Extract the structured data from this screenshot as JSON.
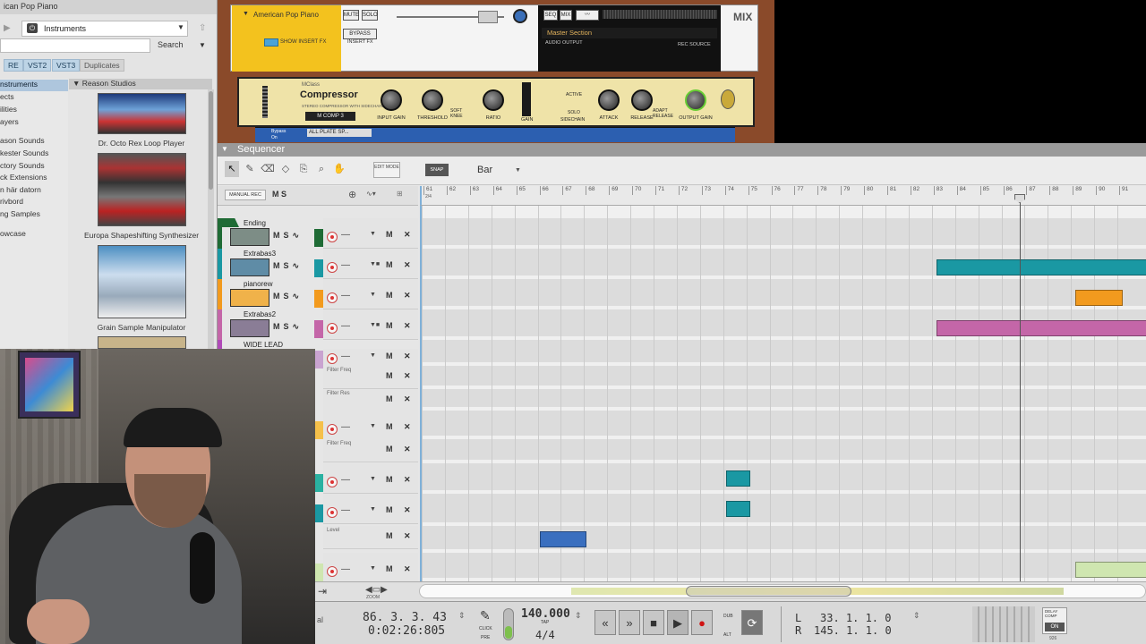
{
  "browser": {
    "title": "ican Pop Piano",
    "location": "Instruments",
    "search_label": "Search",
    "filter_tabs": [
      "RE",
      "VST2",
      "VST3",
      "Duplicates"
    ],
    "sidebar_items": [
      "nstruments",
      "ects",
      "ilities",
      "ayers",
      "ason Sounds",
      "kester Sounds",
      "ctory Sounds",
      "ck Extensions",
      "n här datorn",
      "rivbord",
      "ng Samples",
      "owcase"
    ],
    "folder": "Reason Studios",
    "devices": [
      "Dr. Octo Rex Loop Player",
      "Europa Shapeshifting Synthesizer",
      "Grain Sample Manipulator"
    ]
  },
  "rack": {
    "piano_name": "American Pop Piano",
    "show_insert_fx": "SHOW INSERT FX",
    "mute": "MUTE",
    "solo": "SOLO",
    "bypass": "BYPASS",
    "insert_fx": "INSERT FX",
    "seq": "SEQ",
    "mix_btn": "MIX",
    "master_section": "Master Section",
    "audio_output": "AUDIO OUTPUT",
    "rec_source": "REC SOURCE",
    "mix_label": "MIX",
    "comp_brand": "MClass",
    "comp_name": "Compressor",
    "comp_sub": "STEREO COMPRESSOR WITH SIDECHAIN",
    "comp_patch": "M COMP 3",
    "knobs": [
      "INPUT GAIN",
      "THRESHOLD",
      "RATIO",
      "ATTACK",
      "RELEASE",
      "OUTPUT GAIN"
    ],
    "soft_knee": "SOFT KNEE",
    "gain": "GAIN",
    "active": "ACTIVE",
    "sidechain": "SIDECHAIN",
    "solo_sc": "SOLO",
    "adapt_release": "ADAPT RELEASE",
    "plate_bypass": "Bypass",
    "plate_on": "On",
    "plate_patch": "ALL PLATE SP..."
  },
  "sequencer": {
    "title": "Sequencer",
    "edit_mode": "EDIT MODE",
    "snap": "SNAP",
    "snap_value": "Bar",
    "manual_rec": "MANUAL REC",
    "ms": "M S",
    "ruler_bars": [
      "61",
      "62",
      "63",
      "64",
      "65",
      "66",
      "67",
      "68",
      "69",
      "70",
      "71",
      "72",
      "73",
      "74",
      "75",
      "76",
      "77",
      "78",
      "79",
      "80",
      "81",
      "82",
      "83",
      "84",
      "85",
      "86",
      "87",
      "88",
      "89",
      "90",
      "91"
    ],
    "ruler_sub": "2/4",
    "tracks": [
      {
        "name": "Ending",
        "color": "#1f6b35"
      },
      {
        "name": "Extrabas3",
        "color": "#1a98a3"
      },
      {
        "name": "pianorew",
        "color": "#f29a1e"
      },
      {
        "name": "Extrabas2",
        "color": "#c466a8"
      },
      {
        "name": "WIDE LEAD",
        "color": "#b04ab8"
      }
    ],
    "sub_lanes": {
      "filter_freq": "Filter Freq",
      "filter_res": "Filter Res",
      "filter_freq2": "Filter Freq",
      "level": "Level"
    },
    "mx": "M ✕",
    "zoom": "ZOOM"
  },
  "transport": {
    "position": "86. 3. 3. 43",
    "time": "0:02:26:805",
    "click": "CLICK",
    "pre": "PRE",
    "tempo": "140.000",
    "tap": "TAP",
    "signature": "4/4",
    "dub": "DUB",
    "alt": "ALT",
    "loop_l_label": "L",
    "loop_l": "33.  1.  1.     0",
    "loop_r_label": "R",
    "loop_r": "145.  1.  1.     0",
    "delay_comp": "DELAY COMP",
    "delay_on": "ON",
    "delay_val": "926",
    "left_label": "al"
  },
  "colors": {
    "teal": "#1a98a3",
    "orange": "#f29a1e",
    "pink": "#c466a8",
    "green": "#1f6b35",
    "blue_clip": "#3a6fbf",
    "light_green_clip": "#cfe6b0"
  }
}
